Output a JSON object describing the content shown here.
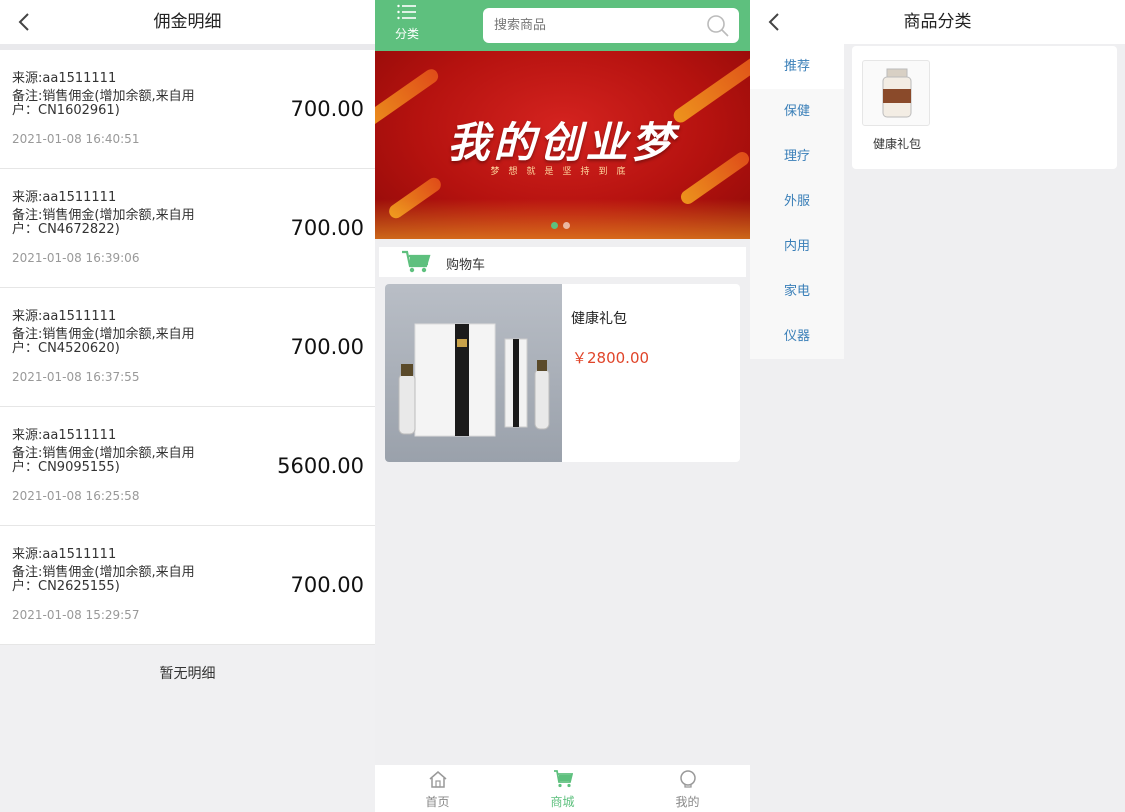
{
  "left": {
    "title": "佣金明细",
    "records": [
      {
        "source": "来源:aa1511111",
        "note": "备注:销售佣金(增加余额,来自用户：CN1602961)",
        "amount": "700.00",
        "time": "2021-01-08 16:40:51"
      },
      {
        "source": "来源:aa1511111",
        "note": "备注:销售佣金(增加余额,来自用户：CN4672822)",
        "amount": "700.00",
        "time": "2021-01-08 16:39:06"
      },
      {
        "source": "来源:aa1511111",
        "note": "备注:销售佣金(增加余额,来自用户：CN4520620)",
        "amount": "700.00",
        "time": "2021-01-08 16:37:55"
      },
      {
        "source": "来源:aa1511111",
        "note": "备注:销售佣金(增加余额,来自用户：CN9095155)",
        "amount": "5600.00",
        "time": "2021-01-08 16:25:58"
      },
      {
        "source": "来源:aa1511111",
        "note": "备注:销售佣金(增加余额,来自用户：CN2625155)",
        "amount": "700.00",
        "time": "2021-01-08 15:29:57"
      }
    ],
    "empty_text": "暂无明细"
  },
  "mid": {
    "category_label": "分类",
    "search_placeholder": "搜索商品",
    "banner_title": "我的创业梦",
    "banner_subtitle": "梦想就是坚持到底",
    "cart_label": "购物车",
    "product": {
      "name": "健康礼包",
      "price": "￥2800.00"
    },
    "tabs": [
      {
        "label": "首页",
        "icon": "home-icon"
      },
      {
        "label": "商城",
        "icon": "cart-icon"
      },
      {
        "label": "我的",
        "icon": "user-icon"
      }
    ],
    "accent_color": "#5ec07e"
  },
  "right": {
    "title": "商品分类",
    "categories": [
      "推荐",
      "保健",
      "理疗",
      "外服",
      "内用",
      "家电",
      "仪器"
    ],
    "goods": [
      {
        "name": "健康礼包"
      }
    ]
  }
}
